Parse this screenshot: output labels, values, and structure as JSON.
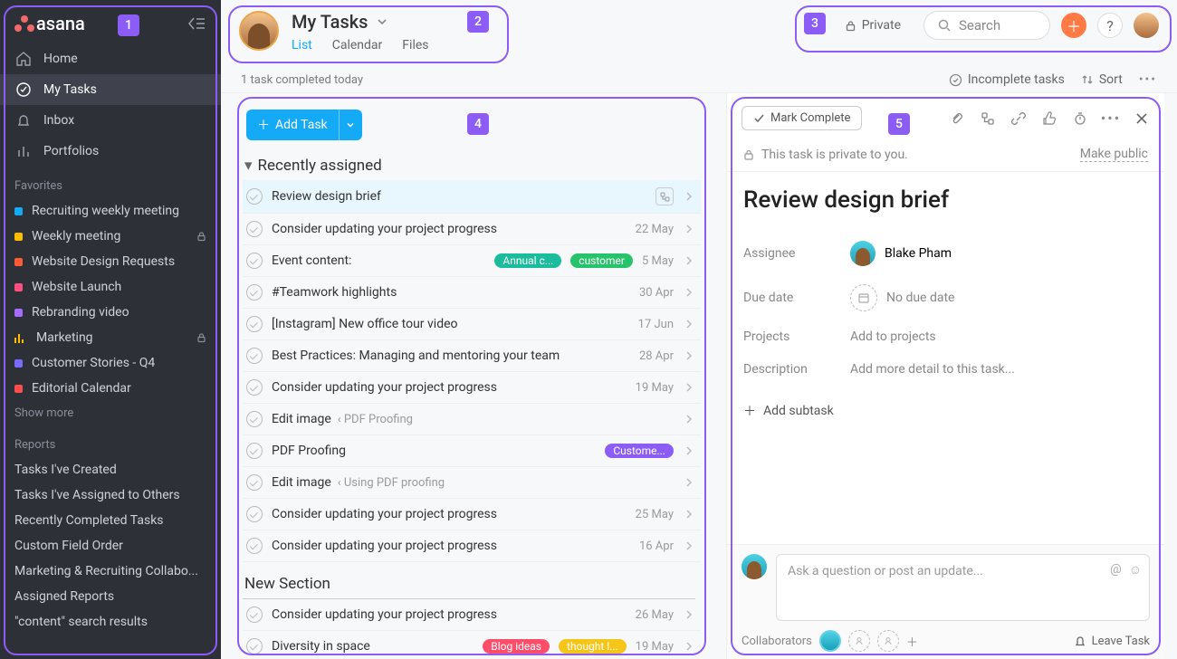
{
  "app": {
    "name": "asana"
  },
  "sidebar": {
    "nav": [
      {
        "label": "Home"
      },
      {
        "label": "My Tasks"
      },
      {
        "label": "Inbox"
      },
      {
        "label": "Portfolios"
      }
    ],
    "favorites_label": "Favorites",
    "favorites": [
      {
        "label": "Recruiting weekly meeting",
        "color": "#14aaf5",
        "locked": false
      },
      {
        "label": "Weekly meeting",
        "color": "#fcbd01",
        "locked": true
      },
      {
        "label": "Website Design Requests",
        "color": "#ff5a36",
        "locked": false
      },
      {
        "label": "Website Launch",
        "color": "#ff4f81",
        "locked": false
      },
      {
        "label": "Rebranding video",
        "color": "#a66bff",
        "locked": false
      },
      {
        "label": "Marketing",
        "color": "_bars",
        "locked": true
      },
      {
        "label": "Customer Stories - Q4",
        "color": "#7a6bff",
        "locked": false
      },
      {
        "label": "Editorial Calendar",
        "color": "#ff4d4d",
        "locked": false
      }
    ],
    "show_more": "Show more",
    "reports_label": "Reports",
    "reports": [
      "Tasks I've Created",
      "Tasks I've Assigned to Others",
      "Recently Completed Tasks",
      "Custom Field Order",
      "Marketing & Recruiting Collabo...",
      "Assigned Reports",
      "\"content\" search results"
    ]
  },
  "header": {
    "title": "My Tasks",
    "tabs": [
      "List",
      "Calendar",
      "Files"
    ],
    "private_label": "Private",
    "search_placeholder": "Search"
  },
  "subheader": {
    "status": "1 task completed today",
    "filter": "Incomplete tasks",
    "sort": "Sort"
  },
  "list": {
    "add_task": "Add Task",
    "section1": "Recently assigned",
    "new_section": "New Section",
    "tasks": [
      {
        "title": "Review design brief",
        "due": "",
        "selected": true,
        "subtask_badge": true
      },
      {
        "title": "Consider updating your project progress",
        "due": "22 May"
      },
      {
        "title": "Event content:",
        "due": "5 May",
        "pills": [
          {
            "text": "Annual c...",
            "bg": "#1abc9c"
          },
          {
            "text": "customer",
            "bg": "#27c26c"
          }
        ]
      },
      {
        "title": "#Teamwork highlights",
        "due": "30 Apr"
      },
      {
        "title": "[Instagram] New office tour video",
        "due": "17 Jun"
      },
      {
        "title": "Best Practices: Managing and mentoring your team",
        "due": "28 Apr"
      },
      {
        "title": "Consider updating your project progress",
        "due": "19 May"
      },
      {
        "title": "Edit image",
        "context": "‹ PDF Proofing",
        "due": ""
      },
      {
        "title": "PDF Proofing",
        "due": "",
        "pills": [
          {
            "text": "Custome...",
            "bg": "#8b5cf6"
          }
        ]
      },
      {
        "title": "Edit image",
        "context": "‹ Using PDF proofing",
        "due": ""
      },
      {
        "title": "Consider updating your project progress",
        "due": "25 May"
      },
      {
        "title": "Consider updating your project progress",
        "due": "16 Apr"
      }
    ],
    "tasks2": [
      {
        "title": "Consider updating your project progress",
        "due": "26 May"
      },
      {
        "title": "Diversity in space",
        "due": "19 May",
        "pills": [
          {
            "text": "Blog ideas",
            "bg": "#ff4d6a"
          },
          {
            "text": "thought l...",
            "bg": "#f5c518"
          }
        ]
      }
    ]
  },
  "detail": {
    "mark_complete": "Mark Complete",
    "privacy_msg": "This task is private to you.",
    "make_public": "Make public",
    "title": "Review design brief",
    "fields": {
      "assignee_label": "Assignee",
      "assignee_name": "Blake Pham",
      "due_label": "Due date",
      "due_value": "No due date",
      "projects_label": "Projects",
      "projects_value": "Add to projects",
      "description_label": "Description",
      "description_ph": "Add more detail to this task..."
    },
    "add_subtask": "Add subtask",
    "comment_ph": "Ask a question or post an update...",
    "collaborators_label": "Collaborators",
    "leave": "Leave Task"
  },
  "annotations": [
    "1",
    "2",
    "3",
    "4",
    "5"
  ]
}
